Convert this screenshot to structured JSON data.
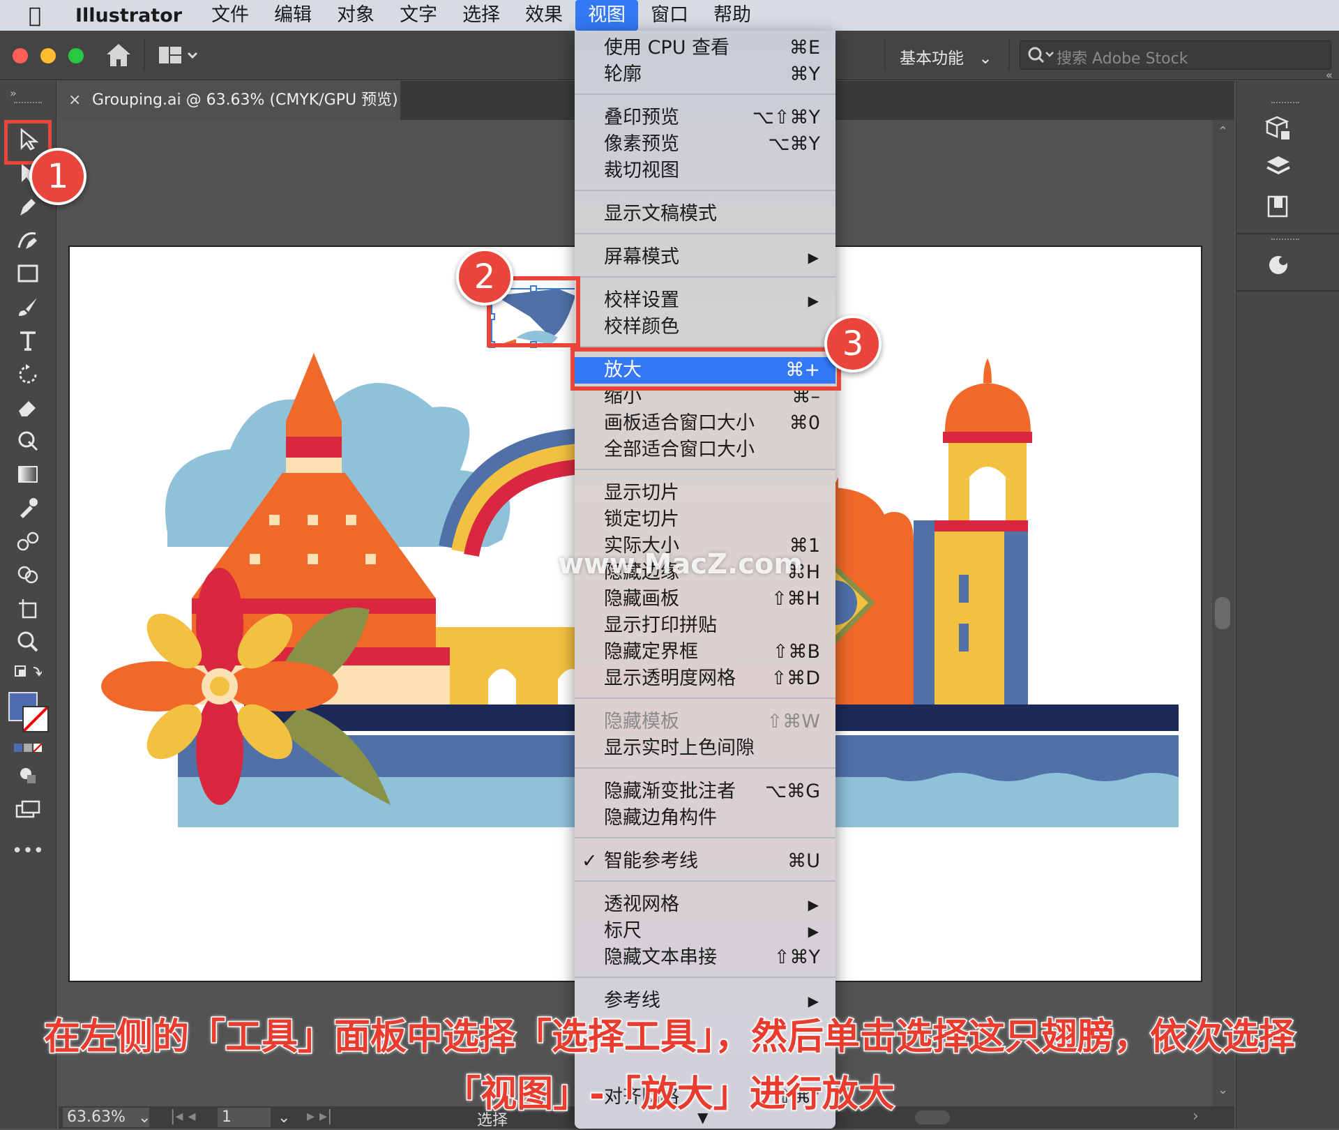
{
  "menubar": {
    "app_name": "Illustrator",
    "items": [
      "文件",
      "编辑",
      "对象",
      "文字",
      "选择",
      "效果",
      "视图",
      "窗口",
      "帮助"
    ],
    "active_item": "视图"
  },
  "appbar": {
    "workspace_label": "基本功能",
    "stock_search_placeholder": "搜索 Adobe Stock"
  },
  "document": {
    "tab_title": "Grouping.ai @ 63.63% (CMYK/GPU 预览)",
    "close_glyph": "×"
  },
  "statusbar": {
    "zoom": "63.63%",
    "artboard_number": "1",
    "status_text": "选择"
  },
  "view_menu": {
    "items": [
      {
        "label": "使用 CPU 查看",
        "shortcut": "⌘E"
      },
      {
        "label": "轮廓",
        "shortcut": "⌘Y"
      },
      {
        "label": "叠印预览",
        "shortcut": "⌥⇧⌘Y"
      },
      {
        "label": "像素预览",
        "shortcut": "⌥⌘Y"
      },
      {
        "label": "裁切视图",
        "shortcut": ""
      },
      {
        "label": "显示文稿模式",
        "shortcut": ""
      },
      {
        "label": "屏幕模式",
        "shortcut": "",
        "submenu": true
      },
      {
        "label": "校样设置",
        "shortcut": "",
        "submenu": true
      },
      {
        "label": "校样颜色",
        "shortcut": ""
      },
      {
        "label": "放大",
        "shortcut": "⌘+",
        "highlighted": true
      },
      {
        "label": "缩小",
        "shortcut": "⌘–"
      },
      {
        "label": "画板适合窗口大小",
        "shortcut": "⌘0"
      },
      {
        "label": "全部适合窗口大小",
        "shortcut": ""
      },
      {
        "label": "显示切片",
        "shortcut": ""
      },
      {
        "label": "锁定切片",
        "shortcut": ""
      },
      {
        "label": "实际大小",
        "shortcut": "⌘1"
      },
      {
        "label": "隐藏边缘",
        "shortcut": "⌘H"
      },
      {
        "label": "隐藏画板",
        "shortcut": "⇧⌘H"
      },
      {
        "label": "显示打印拼贴",
        "shortcut": ""
      },
      {
        "label": "隐藏定界框",
        "shortcut": "⇧⌘B"
      },
      {
        "label": "显示透明度网格",
        "shortcut": "⇧⌘D"
      },
      {
        "label": "隐藏模板",
        "shortcut": "⇧⌘W",
        "disabled": true
      },
      {
        "label": "显示实时上色间隙",
        "shortcut": ""
      },
      {
        "label": "隐藏渐变批注者",
        "shortcut": "⌥⌘G"
      },
      {
        "label": "隐藏边角构件",
        "shortcut": ""
      },
      {
        "label": "智能参考线",
        "shortcut": "⌘U",
        "checked": true
      },
      {
        "label": "透视网格",
        "shortcut": "",
        "submenu": true
      },
      {
        "label": "标尺",
        "shortcut": "",
        "submenu": true
      },
      {
        "label": "隐藏文本串接",
        "shortcut": "⇧⌘Y"
      },
      {
        "label": "参考线",
        "shortcut": "",
        "submenu": true
      },
      {
        "label": "对齐网格",
        "shortcut": "⇧⌘\""
      }
    ]
  },
  "annotations": {
    "badge_1": "1",
    "badge_2": "2",
    "badge_3": "3",
    "caption_line1": "在左侧的「工具」面板中选择「选择工具」，然后单击选择这只翅膀，依次选择",
    "caption_line2": "「视图」-「放大」进行放大",
    "watermark": "www.MacZ.com"
  },
  "colors": {
    "accent_blue": "#3478f6",
    "callout_red": "#e9453a",
    "orange": "#f0692a",
    "red": "#d9273f",
    "yellow": "#f2c142",
    "navy": "#1d2a57",
    "wave_blue": "#5070a8",
    "light_blue": "#8fc1d8",
    "olive": "#889146"
  },
  "icons": {
    "apple": "apple-logo-icon",
    "home": "home-icon",
    "selection_tool": "selection-arrow-icon",
    "search": "search-icon",
    "menu_checkmark": "checkmark-icon",
    "submenu_arrow": "submenu-arrow-icon"
  }
}
